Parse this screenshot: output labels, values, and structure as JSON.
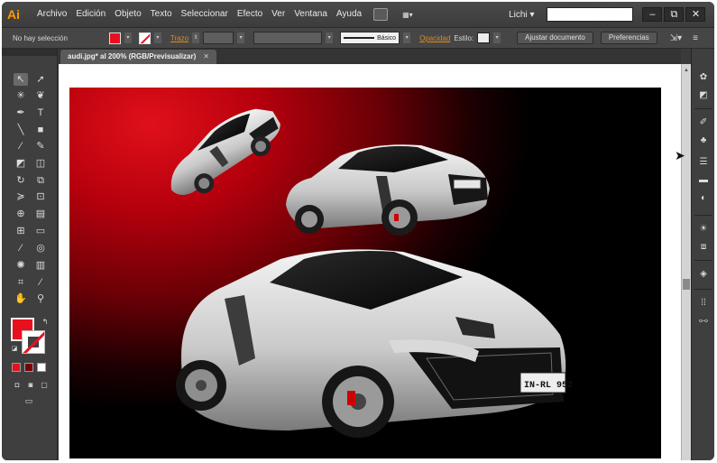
{
  "app": {
    "logo_text": "Ai",
    "menu": [
      "Archivo",
      "Edición",
      "Objeto",
      "Texto",
      "Seleccionar",
      "Efecto",
      "Ver",
      "Ventana",
      "Ayuda"
    ],
    "workspace": "Lichi",
    "search_value": "",
    "window_buttons": [
      "–",
      "⧉",
      "✕"
    ]
  },
  "control_bar": {
    "selection_status": "No hay selección",
    "stroke_link": "Trazo",
    "brush_label": "Básico",
    "opacity_link": "Opacidad",
    "style_label": "Estilo:",
    "align_doc_button": "Ajustar documento",
    "preferences_button": "Preferencias"
  },
  "document": {
    "tab_title": "audi.jpg* al 200% (RGB/Previsualizar)",
    "tab_close": "✕"
  },
  "colors": {
    "fill": "#e8101e",
    "accent": "#ff9a00",
    "artboard_center": "#e0101a",
    "artboard_edge": "#000000"
  },
  "artwork": {
    "license_plate": "IN-RL 952"
  },
  "icons": {
    "tools": [
      "selection-arrow",
      "direct-selection",
      "magic-wand",
      "lasso",
      "pen",
      "type",
      "line",
      "rectangle",
      "paintbrush",
      "pencil",
      "blob-brush",
      "eraser",
      "rotate",
      "scale",
      "width",
      "free-transform",
      "shape-builder",
      "perspective-grid",
      "mesh",
      "gradient",
      "eyedropper",
      "blend",
      "symbol-sprayer",
      "column-graph",
      "artboard",
      "slice",
      "hand",
      "zoom"
    ],
    "right_panel": [
      "color-guide",
      "swatches",
      "brushes",
      "symbols",
      "stroke",
      "gradient",
      "transparency",
      "appearance",
      "graphic-styles",
      "layers",
      "artboards",
      "links"
    ]
  }
}
